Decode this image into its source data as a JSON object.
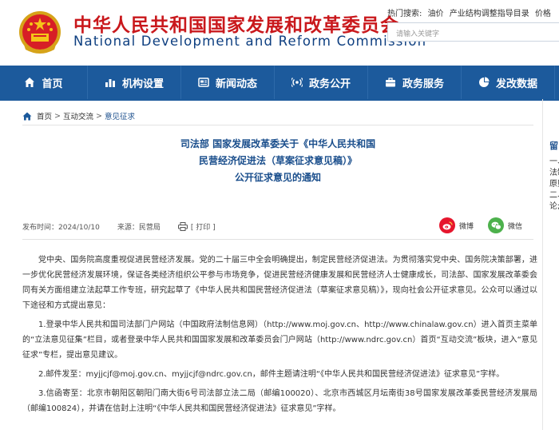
{
  "header": {
    "title_cn": "中华人民共和国国家发展和改革委员会",
    "title_en": "National Development and Reform Commission",
    "hot_search_label": "热门搜索:",
    "hot_search_terms": [
      "油价",
      "产业结构调整指导目录",
      "价格"
    ],
    "search_placeholder": "请输入关键字"
  },
  "nav": {
    "items": [
      "首页",
      "机构设置",
      "新闻动态",
      "政务公开",
      "政务服务",
      "发改数据"
    ]
  },
  "breadcrumb": [
    "首页",
    "互动交流",
    "意见征求"
  ],
  "article": {
    "title_lines": [
      "司法部 国家发展改革委关于《中华人民共和国",
      "民营经济促进法（草案征求意见稿）》",
      "公开征求意见的通知"
    ],
    "publish_date": "发布时间：2024/10/10",
    "source": "来源：民营局",
    "print_label": "[ 打印 ]",
    "share_weibo": "微博",
    "share_wechat": "微信",
    "paragraphs": [
      "党中央、国务院高度重视促进民营经济发展。党的二十届三中全会明确提出，制定民营经济促进法。为贯彻落实党中央、国务院决策部署，进一步优化民营经济发展环境，保证各类经济组织公平参与市场竞争，促进民营经济健康发展和民营经济人士健康成长，司法部、国家发展改革委会同有关方面组建立法起草工作专班，研究起草了《中华人民共和国民营经济促进法（草案征求意见稿）》，现向社会公开征求意见。公众可以通过以下途径和方式提出意见：",
      "1.登录中华人民共和国司法部门户网站（中国政府法制信息网）（http://www.moj.gov.cn、http://www.chinalaw.gov.cn）进入首页主菜单的“立法意见征集”栏目，或者登录中华人民共和国国家发展和改革委员会门户网站（http://www.ndrc.gov.cn）首页“互动交流”板块，进入“意见征求”专栏，提出意见建议。",
      "2.邮件发至：myjjcjf@moj.gov.cn、myjjcjf@ndrc.gov.cn，邮件主题请注明“《中华人民共和国民营经济促进法》征求意见”字样。",
      "3.信函寄至：北京市朝阳区朝阳门南大街6号司法部立法二局（邮编100020）、北京市西城区月坛南街38号国家发展改革委民营经济发展局（邮编100824），并请在信封上注明“《中华人民共和国民营经济促进法》征求意见”字样。"
    ]
  },
  "side": {
    "heading": "留",
    "lines": [
      "一、",
      "法制",
      "原则",
      "二、",
      "论;"
    ]
  },
  "colors": {
    "brand_red": "#c9181c",
    "brand_blue": "#1c5a9c",
    "title_blue": "#1a4e8c",
    "weibo": "#e6162d",
    "wechat": "#4db14c"
  }
}
